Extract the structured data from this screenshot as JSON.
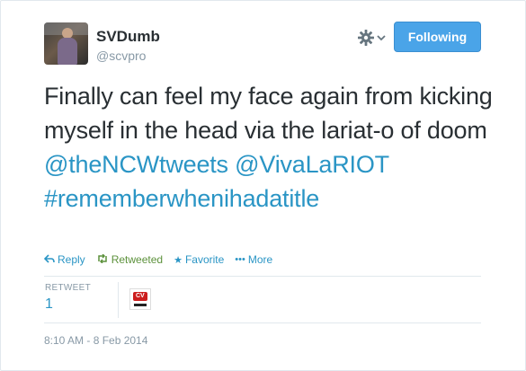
{
  "user": {
    "name": "SVDumb",
    "handle": "@scvpro"
  },
  "header": {
    "follow_label": "Following",
    "gear_icon": "gear-icon",
    "caret_icon": "chevron-down-icon"
  },
  "tweet": {
    "text_plain": "Finally can feel my face again from kicking myself in the head via the lariat-o of doom",
    "mention_1": "@theNCWtweets",
    "mention_2": "@VivaLaRIOT",
    "hashtag": "#rememberwhenihadatitle"
  },
  "actions": {
    "reply": "Reply",
    "retweeted": "Retweeted",
    "favorite": "Favorite",
    "more": "More"
  },
  "stats": {
    "retweet_label": "RETWEET",
    "retweet_count": "1"
  },
  "timestamp": "8:10 AM - 8 Feb 2014",
  "colors": {
    "link": "#2a95c5",
    "retweeted": "#5c913b",
    "follow_button": "#4aa4e8",
    "muted": "#8899a6"
  }
}
